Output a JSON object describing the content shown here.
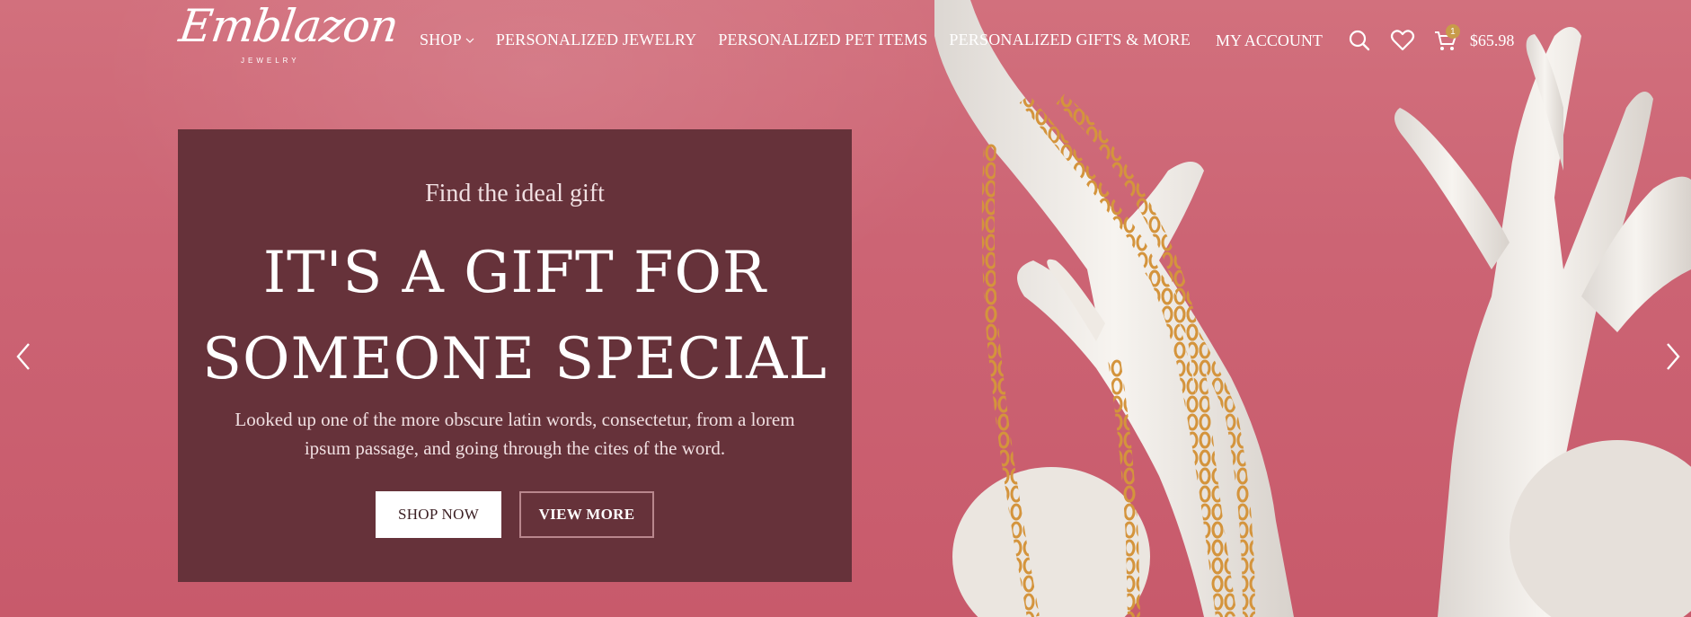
{
  "brand": {
    "logo_text": "Emblazon",
    "logo_sub": "JEWELRY"
  },
  "nav": {
    "items": [
      {
        "label": "SHOP"
      },
      {
        "label": "PERSONALIZED JEWELRY"
      },
      {
        "label": "PERSONALIZED PET ITEMS"
      },
      {
        "label": "PERSONALIZED GIFTS & MORE"
      }
    ]
  },
  "header": {
    "account_label": "MY ACCOUNT",
    "cart_count": "1",
    "cart_total": "$65.98"
  },
  "slide": {
    "eyebrow": "Find the ideal gift",
    "title_line1": "IT'S A GIFT FOR",
    "title_line2": "SOMEONE SPECIAL",
    "text": "Looked up one of the more obscure latin words, consectetur, from a lorem ipsum passage, and going through the cites of the word.",
    "primary_button": "SHOP NOW",
    "secondary_button": "VIEW MORE"
  },
  "icons": {
    "search": "search-icon",
    "wishlist": "heart-icon",
    "cart": "cart-icon",
    "prev": "chevron-left-icon",
    "next": "chevron-right-icon",
    "dropdown": "chevron-down-icon"
  },
  "colors": {
    "background": "#cc6474",
    "slide_box": "#66323a",
    "cart_badge": "#c89b4a",
    "gold": "#d4943c"
  }
}
